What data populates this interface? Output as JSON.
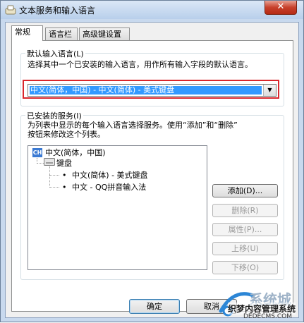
{
  "window": {
    "title": "文本服务和输入语言",
    "close_symbol": "✕"
  },
  "tabs": [
    {
      "label": "常规"
    },
    {
      "label": "语言栏"
    },
    {
      "label": "高级键设置"
    }
  ],
  "default_lang": {
    "title": "默认输入语言(L)",
    "description": "选择其中一个已安装的输入语言，用作所有输入字段的默认语言。",
    "selected_value": "中文(简体，中国) - 中文(简体) - 美式键盘"
  },
  "installed": {
    "title": "已安装的服务(I)",
    "description_line1": "为列表中显示的每个输入语言选择服务。使用“添加”和“删除”",
    "description_line2": "按钮来修改这个列表。",
    "tree": {
      "lang_code": "CH",
      "language": "中文(简体，中国)",
      "group": "键盘",
      "items": [
        "中文(简体) - 美式键盘",
        "中文 - QQ拼音输入法"
      ]
    }
  },
  "buttons": {
    "add": "添加(D)...",
    "remove": "删除(R)",
    "properties": "属性(P)...",
    "move_up": "上移(U)",
    "move_down": "下移(O)"
  },
  "footer": {
    "ok": "确定",
    "cancel": "取消"
  },
  "watermark": {
    "text": "系统城",
    "subtitle": "织梦内容管理系统",
    "url": "DEDECMS.COM"
  },
  "colors": {
    "accent": "#3399ff",
    "highlight_frame": "#d9262c",
    "lang_badge": "#3b7ad3"
  }
}
